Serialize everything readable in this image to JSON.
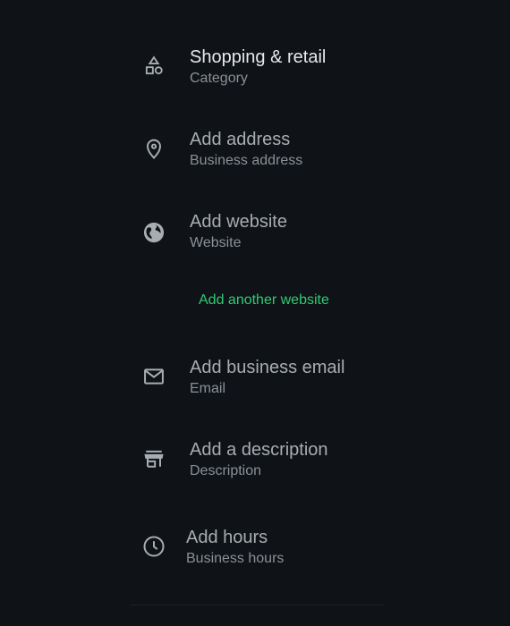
{
  "rows": [
    {
      "title": "Shopping & retail",
      "subtitle": "Category",
      "icon": "category-shapes-icon"
    },
    {
      "title": "Add address",
      "subtitle": "Business address",
      "icon": "location-pin-icon"
    },
    {
      "title": "Add website",
      "subtitle": "Website",
      "icon": "globe-icon"
    },
    {
      "title": "Add business email",
      "subtitle": "Email",
      "icon": "envelope-icon"
    },
    {
      "title": "Add a description",
      "subtitle": "Description",
      "icon": "store-icon"
    },
    {
      "title": "Add hours",
      "subtitle": "Business hours",
      "icon": "clock-icon"
    }
  ],
  "add_another_website": "Add another website",
  "colors": {
    "background": "#0f1317",
    "title_primary": "#e6e9ec",
    "title_secondary": "#a8adb2",
    "subtitle": "#8a9096",
    "link": "#2ecc71"
  }
}
